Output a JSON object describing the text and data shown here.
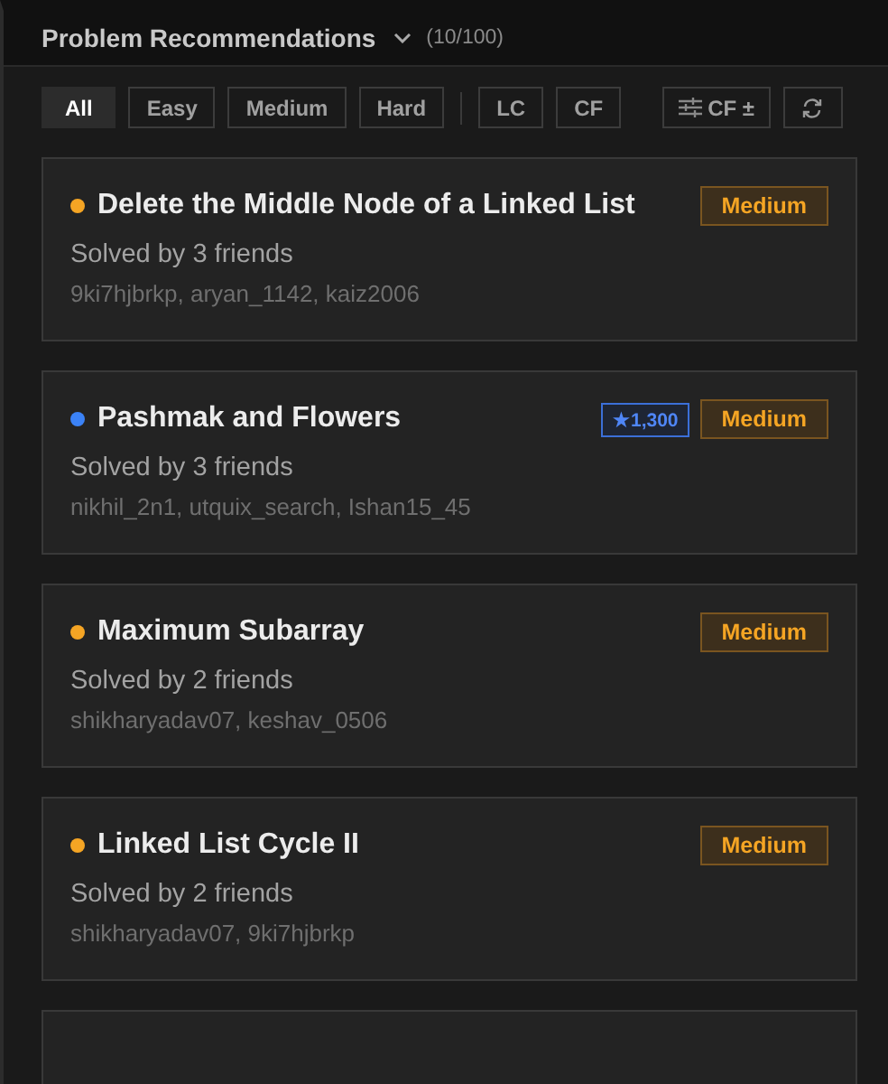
{
  "header": {
    "title": "Problem Recommendations",
    "count": "(10/100)"
  },
  "difficulty_filters": [
    {
      "label": "All",
      "selected": true
    },
    {
      "label": "Easy",
      "selected": false
    },
    {
      "label": "Medium",
      "selected": false
    },
    {
      "label": "Hard",
      "selected": false
    }
  ],
  "platform_filters": [
    {
      "label": "LC",
      "selected": false
    },
    {
      "label": "CF",
      "selected": false
    }
  ],
  "rating_filter": {
    "label": "CF ±"
  },
  "problems": [
    {
      "title": "Delete the Middle Node of a Linked List",
      "color": "#f5a524",
      "difficulty": "Medium",
      "solved_by": "Solved by 3 friends",
      "friends": "9ki7hjbrkp, aryan_1142, kaiz2006"
    },
    {
      "title": "Pashmak and Flowers",
      "color": "#3b82f6",
      "rating": "★1,300",
      "difficulty": "Medium",
      "solved_by": "Solved by 3 friends",
      "friends": "nikhil_2n1, utquix_search, Ishan15_45"
    },
    {
      "title": "Maximum Subarray",
      "color": "#f5a524",
      "difficulty": "Medium",
      "solved_by": "Solved by 2 friends",
      "friends": "shikharyadav07, keshav_0506"
    },
    {
      "title": "Linked List Cycle II",
      "color": "#f5a524",
      "difficulty": "Medium",
      "solved_by": "Solved by 2 friends",
      "friends": "shikharyadav07, 9ki7hjbrkp"
    }
  ]
}
